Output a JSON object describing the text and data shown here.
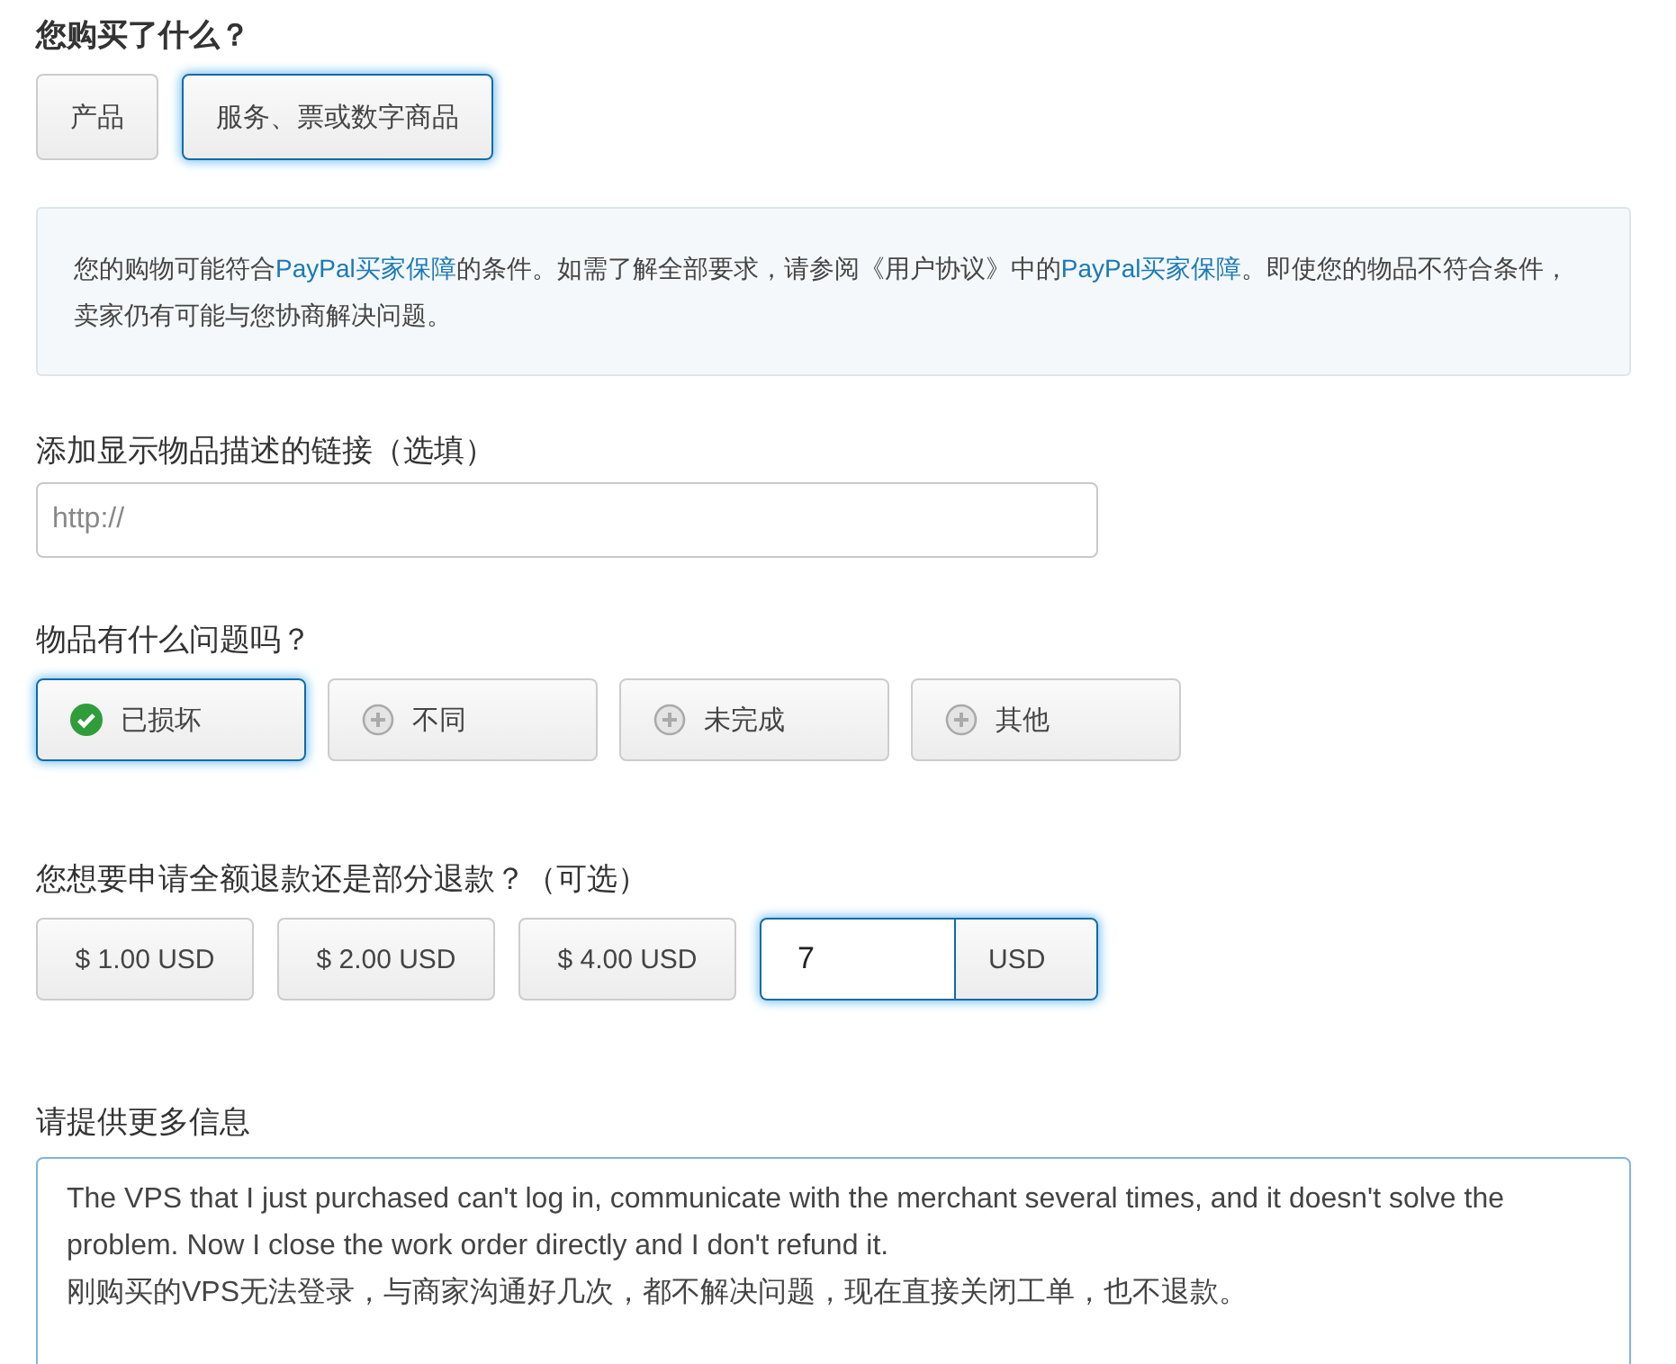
{
  "purchase_type": {
    "label": "您购买了什么？",
    "options": [
      {
        "label": "产品",
        "selected": false
      },
      {
        "label": "服务、票或数字商品",
        "selected": true
      }
    ]
  },
  "notice": {
    "segments": [
      {
        "kind": "text",
        "text": "您的购物可能符合"
      },
      {
        "kind": "link",
        "text": "PayPal买家保障"
      },
      {
        "kind": "text",
        "text": "的条件。如需了解全部要求，请参阅《用户协议》中的"
      },
      {
        "kind": "link",
        "text": "PayPal买家保障"
      },
      {
        "kind": "text",
        "text": "。即使您的物品不符合条件，卖家仍有可能与您协商解决问题。"
      }
    ]
  },
  "link_field": {
    "label": "添加显示物品描述的链接（选填）",
    "placeholder": "http://"
  },
  "issue": {
    "label": "物品有什么问题吗？",
    "options": [
      {
        "label": "已损坏",
        "selected": true
      },
      {
        "label": "不同",
        "selected": false
      },
      {
        "label": "未完成",
        "selected": false
      },
      {
        "label": "其他",
        "selected": false
      }
    ]
  },
  "refund": {
    "label": "您想要申请全额退款还是部分退款？（可选）",
    "options": [
      {
        "label": "$ 1.00 USD",
        "selected": false
      },
      {
        "label": "$ 2.00 USD",
        "selected": false
      },
      {
        "label": "$ 4.00 USD",
        "selected": false
      }
    ],
    "custom": {
      "value": "7",
      "currency": "USD",
      "selected": true
    }
  },
  "details": {
    "label": "请提供更多信息",
    "value": "The VPS that I just purchased can't log in, communicate with the merchant several times, and it doesn't solve the problem. Now I close the work order directly and I don't refund it.\n刚购买的VPS无法登录，与商家沟通好几次，都不解决问题，现在直接关闭工单，也不退款。"
  }
}
